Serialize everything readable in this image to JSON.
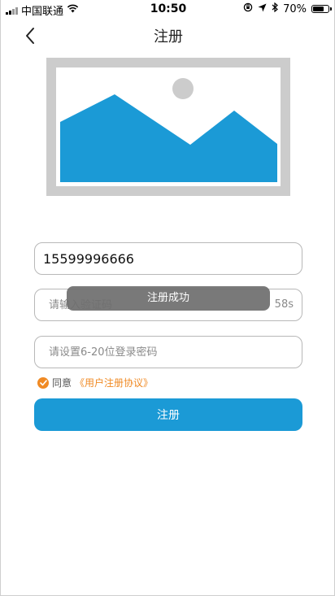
{
  "status_bar": {
    "carrier": "中国联通",
    "time": "10:50",
    "battery_percent": "70%",
    "battery_level": 0.7,
    "icons": [
      "signal-icon",
      "wifi-icon",
      "rotation-lock-icon",
      "location-icon",
      "bluetooth-icon",
      "battery-icon"
    ]
  },
  "nav": {
    "title": "注册",
    "back_icon": "chevron-left-icon"
  },
  "hero": {
    "icon": "image-placeholder-icon",
    "colors": {
      "frame": "#cccccc",
      "mountain": "#1b9ad6",
      "sun": "#cccccc"
    }
  },
  "form": {
    "phone_value": "15599996666",
    "code_placeholder": "请输入验证码",
    "code_countdown": "58s",
    "password_placeholder": "请设置6-20位登录密码"
  },
  "agreement": {
    "checked": true,
    "prefix": "同意",
    "link_text": "《用户注册协议》"
  },
  "register_button": {
    "label": "注册",
    "color": "#1b9ad6"
  },
  "toast": {
    "message": "注册成功"
  },
  "colors": {
    "accent": "#1b9ad6",
    "link": "#f08a24"
  }
}
